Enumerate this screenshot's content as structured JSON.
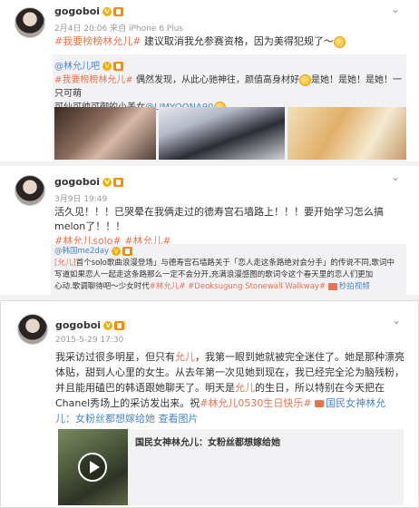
{
  "post1": {
    "user": "gogoboi",
    "meta": "2月4日 20:06 来自 iPhone 6 Plus",
    "hashtag": "#我要榜榜林允儿#",
    "text": " 建议取消我允参赛资格，因为美得犯规了～",
    "repost": {
      "user": "@林允儿吧",
      "line1_pre": " 偶然发现，从此心驰神往，颜值高身材好",
      "line1_post": "是她！是她！是她！一只可萌",
      "line2_pre": "可仙可帅可御的小美女",
      "mention": "@LIMYOONA90"
    }
  },
  "post2": {
    "user": "gogoboi",
    "meta": "3月9日 19:49",
    "line1": "活久见！！！已哭晕在我俩走过的德寿宫石墙路上！！！要开始学习怎么搞melon了！！！",
    "tag1": "#林允儿solo#",
    "tag2": "#林允儿#",
    "repost": {
      "user": "@韩国me2day",
      "line1_tag": "[允儿]",
      "line1_text": "首个solo歌曲浪漫登场」与德寿宫石墙路关于「恋人走这条路绝对会分手」的传说不同,歌词中",
      "line2": "写道如果恋人一起走这条路那么一定不会分开,充满浪漫感图的歌词令这个春天里的恋人们更加",
      "line3_pre": "心动.歌调聊待吧～少女时代",
      "line3_tag1": "#林允儿#",
      "line3_tag2": "#Deoksugung Stonewall Walkway#",
      "line3_video": "秒拍视频"
    }
  },
  "post3": {
    "user": "gogoboi",
    "meta": "2015-5-29 17:30",
    "l1_a": "我采访过很多明星，但只有",
    "l1_hl": "允儿",
    "l1_b": "，我第一眼到她就被完全迷住了。她是那种漂亮",
    "l2": "体贴，甜到人心里的女生。从去年第一次见她到现在，我已经完全沦为脑残粉，",
    "l3": "并且能用磕巴的韩语跟她聊天了。明天是",
    "l3_hl": "允儿",
    "l3_b": "的生日，所以特别在今天把在",
    "l4_a": "Chanel秀场上的采访发出来。祝",
    "l4_tag": "#林允儿0530生日快乐#",
    "l4_link": "国民女神林允",
    "l5_link": "儿：女粉丝都想嫁给她",
    "l5_b": " 查看图片",
    "video_title": "国民女神林允儿：女粉丝都想嫁给她"
  },
  "icons": {
    "verified": "verified-badge-icon",
    "level": "vip-level-icon",
    "more": "chevron-down-icon",
    "play": "play-icon"
  },
  "colors": {
    "link": "#eb7350",
    "blue": "#4a86c5",
    "verified": "#f6b100"
  }
}
